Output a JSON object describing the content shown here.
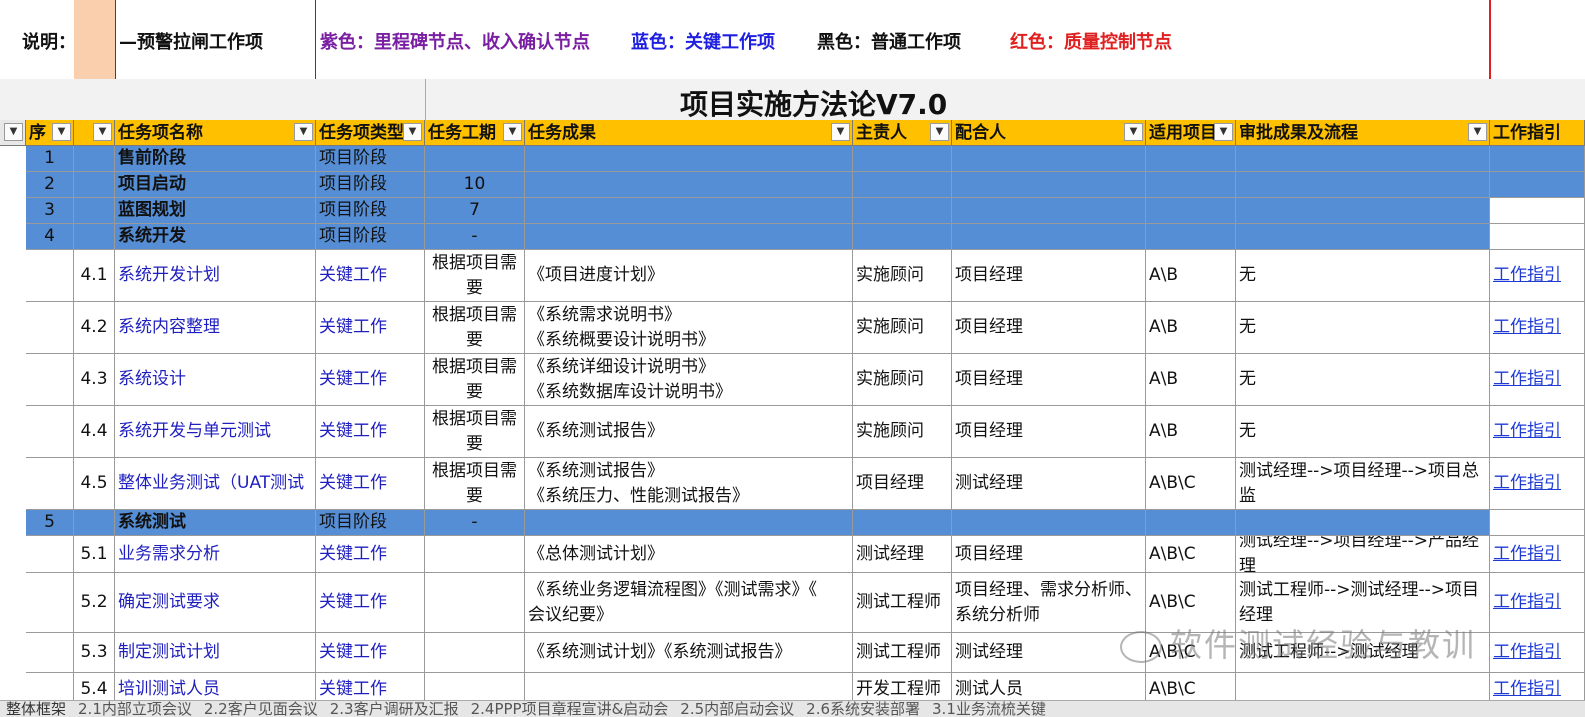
{
  "legend": {
    "label": "说明：",
    "warning_item": "—预警拉闸工作项",
    "purple": "紫色：里程碑节点、收入确认节点",
    "blue": "蓝色：关键工作项",
    "black": "黑色：普通工作项",
    "red": "红色：质量控制节点",
    "colors": {
      "purple": "#7a1fa2",
      "blue": "#1f1fe0",
      "black": "#111111",
      "red": "#e02020",
      "swatch": "#f9cfae"
    }
  },
  "sheet_title": "项目实施方法论V7.0",
  "headers": [
    "序",
    "",
    "任务项名称",
    "任务项类型",
    "任务工期",
    "任务成果",
    "主责人",
    "配合人",
    "适用项目",
    "审批成果及流程",
    "工作指引"
  ],
  "rows": [
    {
      "type": "phase",
      "num": "1",
      "sub": "",
      "name": "售前阶段",
      "task_type": "项目阶段",
      "duration": "",
      "output": [],
      "owner": "",
      "partner": "",
      "applicable": "",
      "approval": "",
      "guide": ""
    },
    {
      "type": "phase",
      "num": "2",
      "sub": "",
      "name": "项目启动",
      "task_type": "项目阶段",
      "duration": "10",
      "output": [],
      "owner": "",
      "partner": "",
      "applicable": "",
      "approval": "",
      "guide": ""
    },
    {
      "type": "phase",
      "num": "3",
      "sub": "",
      "name": "蓝图规划",
      "task_type": "项目阶段",
      "duration": "7",
      "output": [],
      "owner": "",
      "partner": "",
      "applicable": "",
      "approval": "",
      "guide": ""
    },
    {
      "type": "phase",
      "num": "4",
      "sub": "",
      "name": "系统开发",
      "task_type": "项目阶段",
      "duration": "-",
      "output": [],
      "owner": "",
      "partner": "",
      "applicable": "",
      "approval": "",
      "guide": ""
    },
    {
      "type": "task",
      "num": "",
      "sub": "4.1",
      "name": "系统开发计划",
      "task_type": "关键工作",
      "duration": "根据项目需要",
      "output": [
        "《项目进度计划》"
      ],
      "owner": "实施顾问",
      "partner": "项目经理",
      "applicable": "A\\B",
      "approval": "无",
      "guide": "工作指引"
    },
    {
      "type": "task",
      "num": "",
      "sub": "4.2",
      "name": "系统内容整理",
      "task_type": "关键工作",
      "duration": "根据项目需要",
      "output": [
        "《系统需求说明书》",
        "《系统概要设计说明书》"
      ],
      "owner": "实施顾问",
      "partner": "项目经理",
      "applicable": "A\\B",
      "approval": "无",
      "guide": "工作指引"
    },
    {
      "type": "task",
      "num": "",
      "sub": "4.3",
      "name": "系统设计",
      "task_type": "关键工作",
      "duration": "根据项目需要",
      "output": [
        "《系统详细设计说明书》",
        "《系统数据库设计说明书》"
      ],
      "owner": "实施顾问",
      "partner": "项目经理",
      "applicable": "A\\B",
      "approval": "无",
      "guide": "工作指引"
    },
    {
      "type": "task",
      "num": "",
      "sub": "4.4",
      "name": "系统开发与单元测试",
      "task_type": "关键工作",
      "duration": "根据项目需要",
      "output": [
        "《系统测试报告》"
      ],
      "owner": "实施顾问",
      "partner": "项目经理",
      "applicable": "A\\B",
      "approval": "无",
      "guide": "工作指引"
    },
    {
      "type": "task",
      "num": "",
      "sub": "4.5",
      "name": "整体业务测试（UAT测试",
      "task_type": "关键工作",
      "duration": "根据项目需要",
      "output": [
        "《系统测试报告》",
        "《系统压力、性能测试报告》"
      ],
      "owner": "项目经理",
      "partner": "测试经理",
      "applicable": "A\\B\\C",
      "approval": "测试经理-->项目经理-->项目总监",
      "guide": "工作指引"
    },
    {
      "type": "phase",
      "num": "5",
      "sub": "",
      "name": "系统测试",
      "task_type": "项目阶段",
      "duration": "-",
      "output": [],
      "owner": "",
      "partner": "",
      "applicable": "",
      "approval": "",
      "guide": ""
    },
    {
      "type": "task",
      "num": "",
      "sub": "5.1",
      "name": "业务需求分析",
      "task_type": "关键工作",
      "duration": "",
      "output": [
        "《总体测试计划》"
      ],
      "owner": "测试经理",
      "partner": "项目经理",
      "applicable": "A\\B\\C",
      "approval": "测试经理-->项目经理-->产品经理",
      "guide": "工作指引"
    },
    {
      "type": "task",
      "num": "",
      "sub": "5.2",
      "name": "确定测试要求",
      "task_type": "关键工作",
      "duration": "",
      "output": [
        "《系统业务逻辑流程图》《测试需求》《",
        "会议纪要》"
      ],
      "owner": "测试工程师",
      "partner": "项目经理、需求分析师、系统分析师",
      "applicable": "A\\B\\C",
      "approval": "测试工程师-->测试经理-->项目经理",
      "guide": "工作指引"
    },
    {
      "type": "task",
      "num": "",
      "sub": "5.3",
      "name": "制定测试计划",
      "task_type": "关键工作",
      "duration": "",
      "output": [
        "《系统测试计划》《系统测试报告》"
      ],
      "owner": "测试工程师",
      "partner": "测试经理",
      "applicable": "A\\B\\C",
      "approval": "测试工程师-->测试经理",
      "guide": "工作指引"
    },
    {
      "type": "task",
      "num": "",
      "sub": "5.4",
      "name": "培训测试人员",
      "task_type": "关键工作",
      "duration": "",
      "output": [],
      "owner": "开发工程师",
      "partner": "测试人员",
      "applicable": "A\\B\\C",
      "approval": "",
      "guide": "工作指引"
    }
  ],
  "watermark": "软件测试经验与教训",
  "sheet_tabs": [
    "整体框架",
    "2.1内部立项会议",
    "2.2客户见面会议",
    "2.3客户调研及汇报",
    "2.4PPP项目章程宣讲&启动会",
    "2.5内部启动会议",
    "2.6系统安装部署",
    "3.1业务流梳关键"
  ]
}
